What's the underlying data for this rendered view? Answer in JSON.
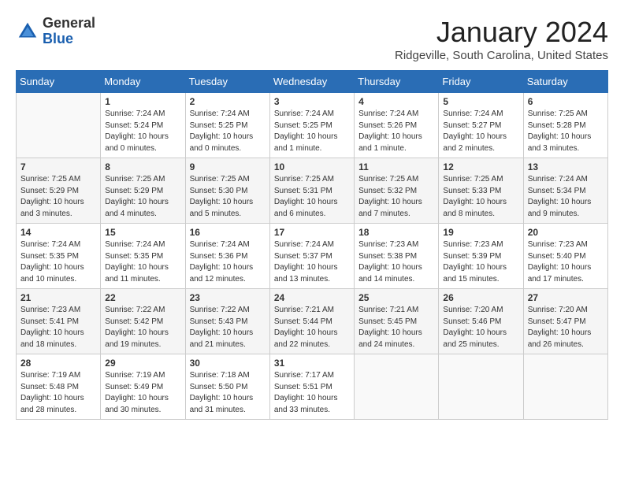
{
  "header": {
    "logo_line1": "General",
    "logo_line2": "Blue",
    "month_title": "January 2024",
    "location": "Ridgeville, South Carolina, United States"
  },
  "calendar": {
    "days_of_week": [
      "Sunday",
      "Monday",
      "Tuesday",
      "Wednesday",
      "Thursday",
      "Friday",
      "Saturday"
    ],
    "weeks": [
      [
        {
          "day": "",
          "info": ""
        },
        {
          "day": "1",
          "info": "Sunrise: 7:24 AM\nSunset: 5:24 PM\nDaylight: 10 hours\nand 0 minutes."
        },
        {
          "day": "2",
          "info": "Sunrise: 7:24 AM\nSunset: 5:25 PM\nDaylight: 10 hours\nand 0 minutes."
        },
        {
          "day": "3",
          "info": "Sunrise: 7:24 AM\nSunset: 5:25 PM\nDaylight: 10 hours\nand 1 minute."
        },
        {
          "day": "4",
          "info": "Sunrise: 7:24 AM\nSunset: 5:26 PM\nDaylight: 10 hours\nand 1 minute."
        },
        {
          "day": "5",
          "info": "Sunrise: 7:24 AM\nSunset: 5:27 PM\nDaylight: 10 hours\nand 2 minutes."
        },
        {
          "day": "6",
          "info": "Sunrise: 7:25 AM\nSunset: 5:28 PM\nDaylight: 10 hours\nand 3 minutes."
        }
      ],
      [
        {
          "day": "7",
          "info": "Sunrise: 7:25 AM\nSunset: 5:29 PM\nDaylight: 10 hours\nand 3 minutes."
        },
        {
          "day": "8",
          "info": "Sunrise: 7:25 AM\nSunset: 5:29 PM\nDaylight: 10 hours\nand 4 minutes."
        },
        {
          "day": "9",
          "info": "Sunrise: 7:25 AM\nSunset: 5:30 PM\nDaylight: 10 hours\nand 5 minutes."
        },
        {
          "day": "10",
          "info": "Sunrise: 7:25 AM\nSunset: 5:31 PM\nDaylight: 10 hours\nand 6 minutes."
        },
        {
          "day": "11",
          "info": "Sunrise: 7:25 AM\nSunset: 5:32 PM\nDaylight: 10 hours\nand 7 minutes."
        },
        {
          "day": "12",
          "info": "Sunrise: 7:25 AM\nSunset: 5:33 PM\nDaylight: 10 hours\nand 8 minutes."
        },
        {
          "day": "13",
          "info": "Sunrise: 7:24 AM\nSunset: 5:34 PM\nDaylight: 10 hours\nand 9 minutes."
        }
      ],
      [
        {
          "day": "14",
          "info": "Sunrise: 7:24 AM\nSunset: 5:35 PM\nDaylight: 10 hours\nand 10 minutes."
        },
        {
          "day": "15",
          "info": "Sunrise: 7:24 AM\nSunset: 5:35 PM\nDaylight: 10 hours\nand 11 minutes."
        },
        {
          "day": "16",
          "info": "Sunrise: 7:24 AM\nSunset: 5:36 PM\nDaylight: 10 hours\nand 12 minutes."
        },
        {
          "day": "17",
          "info": "Sunrise: 7:24 AM\nSunset: 5:37 PM\nDaylight: 10 hours\nand 13 minutes."
        },
        {
          "day": "18",
          "info": "Sunrise: 7:23 AM\nSunset: 5:38 PM\nDaylight: 10 hours\nand 14 minutes."
        },
        {
          "day": "19",
          "info": "Sunrise: 7:23 AM\nSunset: 5:39 PM\nDaylight: 10 hours\nand 15 minutes."
        },
        {
          "day": "20",
          "info": "Sunrise: 7:23 AM\nSunset: 5:40 PM\nDaylight: 10 hours\nand 17 minutes."
        }
      ],
      [
        {
          "day": "21",
          "info": "Sunrise: 7:23 AM\nSunset: 5:41 PM\nDaylight: 10 hours\nand 18 minutes."
        },
        {
          "day": "22",
          "info": "Sunrise: 7:22 AM\nSunset: 5:42 PM\nDaylight: 10 hours\nand 19 minutes."
        },
        {
          "day": "23",
          "info": "Sunrise: 7:22 AM\nSunset: 5:43 PM\nDaylight: 10 hours\nand 21 minutes."
        },
        {
          "day": "24",
          "info": "Sunrise: 7:21 AM\nSunset: 5:44 PM\nDaylight: 10 hours\nand 22 minutes."
        },
        {
          "day": "25",
          "info": "Sunrise: 7:21 AM\nSunset: 5:45 PM\nDaylight: 10 hours\nand 24 minutes."
        },
        {
          "day": "26",
          "info": "Sunrise: 7:20 AM\nSunset: 5:46 PM\nDaylight: 10 hours\nand 25 minutes."
        },
        {
          "day": "27",
          "info": "Sunrise: 7:20 AM\nSunset: 5:47 PM\nDaylight: 10 hours\nand 26 minutes."
        }
      ],
      [
        {
          "day": "28",
          "info": "Sunrise: 7:19 AM\nSunset: 5:48 PM\nDaylight: 10 hours\nand 28 minutes."
        },
        {
          "day": "29",
          "info": "Sunrise: 7:19 AM\nSunset: 5:49 PM\nDaylight: 10 hours\nand 30 minutes."
        },
        {
          "day": "30",
          "info": "Sunrise: 7:18 AM\nSunset: 5:50 PM\nDaylight: 10 hours\nand 31 minutes."
        },
        {
          "day": "31",
          "info": "Sunrise: 7:17 AM\nSunset: 5:51 PM\nDaylight: 10 hours\nand 33 minutes."
        },
        {
          "day": "",
          "info": ""
        },
        {
          "day": "",
          "info": ""
        },
        {
          "day": "",
          "info": ""
        }
      ]
    ]
  }
}
